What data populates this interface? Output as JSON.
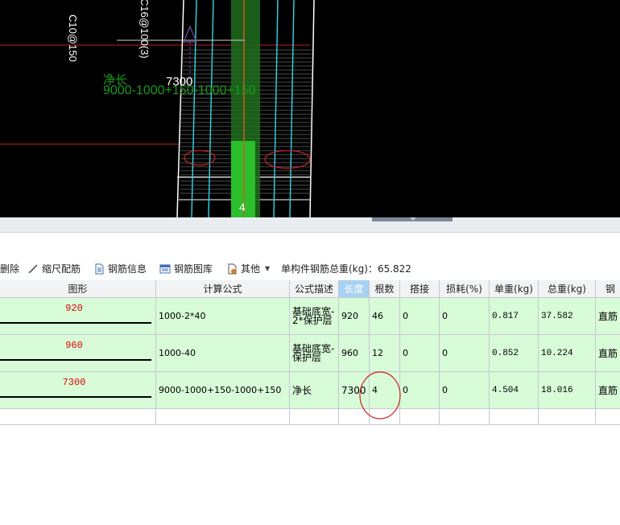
{
  "drawing": {
    "net_length_label": "净长",
    "length_value": "7300",
    "formula_text": "9000-1000+150-1000+150",
    "rotated_text_1": "C10@150",
    "rotated_text_2": "C16@100(3)",
    "bar_count_marker": "4"
  },
  "toolbar": {
    "delete_label": "删除",
    "scale_rebar_label": "缩尺配筋",
    "rebar_info_label": "钢筋信息",
    "rebar_library_label": "钢筋图库",
    "other_label": "其他",
    "total_weight_label": "单构件钢筋总重(kg)：",
    "total_weight_value": "65.822"
  },
  "grid": {
    "headers": {
      "shape": "图形",
      "formula": "计算公式",
      "formula_desc": "公式描述",
      "length": "长度",
      "count": "根数",
      "lap": "搭接",
      "loss": "损耗(%)",
      "unit_weight": "单重(kg)",
      "total_weight": "总重(kg)",
      "rebar_type": "钢筋"
    },
    "rows": [
      {
        "shape_value": "920",
        "formula": "1000-2*40",
        "formula_desc": "基础底宽-2*保护层",
        "length": "920",
        "count": "46",
        "lap": "0",
        "loss": "0",
        "unit_weight": "0.817",
        "total_weight": "37.582",
        "rebar_type": "直筋"
      },
      {
        "shape_value": "960",
        "formula": "1000-40",
        "formula_desc": "基础底宽-保护层",
        "length": "960",
        "count": "12",
        "lap": "0",
        "loss": "0",
        "unit_weight": "0.852",
        "total_weight": "10.224",
        "rebar_type": "直筋"
      },
      {
        "shape_value": "7300",
        "formula": "9000-1000+150-1000+150",
        "formula_desc": "净长",
        "length": "7300",
        "count": "4",
        "lap": "0",
        "loss": "0",
        "unit_weight": "4.504",
        "total_weight": "18.016",
        "rebar_type": "直筋"
      }
    ]
  },
  "colors": {
    "cad_background": "#000000",
    "dimension_text": "#1a9a1a",
    "annotation_circle": "#d02020",
    "row_highlight": "#d8fbd8",
    "header_highlight": "#a9d1f3"
  }
}
